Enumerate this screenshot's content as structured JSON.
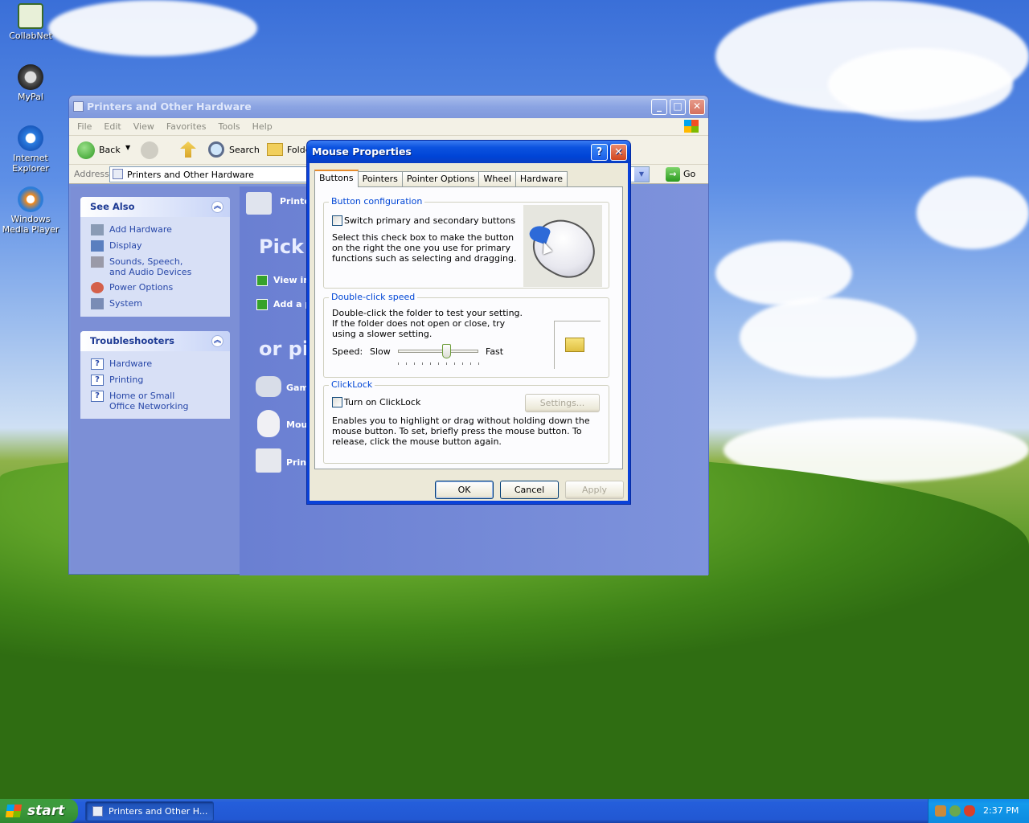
{
  "desktop": {
    "icons": [
      {
        "label": "CollabNet"
      },
      {
        "label": "MyPal"
      },
      {
        "label": "Internet Explorer"
      },
      {
        "label": "Windows Media Player"
      }
    ]
  },
  "explorer": {
    "title": "Printers and Other Hardware",
    "menu": [
      "File",
      "Edit",
      "View",
      "Favorites",
      "Tools",
      "Help"
    ],
    "toolbar": {
      "back": "Back",
      "search": "Search",
      "folders": "Folde"
    },
    "address": {
      "label": "Address",
      "value": "Printers and Other Hardware",
      "go": "Go"
    },
    "see_also": {
      "title": "See Also",
      "items": [
        "Add Hardware",
        "Display",
        "Sounds, Speech, and Audio Devices",
        "Power Options",
        "System"
      ]
    },
    "troubleshooters": {
      "title": "Troubleshooters",
      "items": [
        "Hardware",
        "Printing",
        "Home or Small Office Networking"
      ]
    },
    "main": {
      "header": "Printe",
      "pick": "Pick",
      "tasks": [
        "View in",
        "Add a p"
      ],
      "or_pick": "or pi",
      "icons": [
        "Gam",
        "Mou",
        "Print"
      ]
    }
  },
  "dialog": {
    "title": "Mouse Properties",
    "tabs": [
      "Buttons",
      "Pointers",
      "Pointer Options",
      "Wheel",
      "Hardware"
    ],
    "active_tab": "Buttons",
    "button_config": {
      "label": "Button configuration",
      "checkbox": "Switch primary and secondary buttons",
      "checked": false,
      "desc": "Select this check box to make the button on the right the one you use for primary functions such as selecting and dragging."
    },
    "double_click": {
      "label": "Double-click speed",
      "desc": "Double-click the folder to test your setting. If the folder does not open or close, try using a slower setting.",
      "speed_label": "Speed:",
      "slow": "Slow",
      "fast": "Fast",
      "speed_value": 0.6
    },
    "clicklock": {
      "label": "ClickLock",
      "checkbox": "Turn on ClickLock",
      "checked": false,
      "settings": "Settings...",
      "desc": "Enables you to highlight or drag without holding down the mouse button. To set, briefly press the mouse button. To release, click the mouse button again."
    },
    "buttons": {
      "ok": "OK",
      "cancel": "Cancel",
      "apply": "Apply"
    }
  },
  "taskbar": {
    "start": "start",
    "task": "Printers and Other H...",
    "clock": "2:37 PM"
  },
  "colors": {
    "title_active": "#0a41d8",
    "taskbar": "#245edb",
    "start_green": "#3e9a3e",
    "link": "#2747a8"
  }
}
